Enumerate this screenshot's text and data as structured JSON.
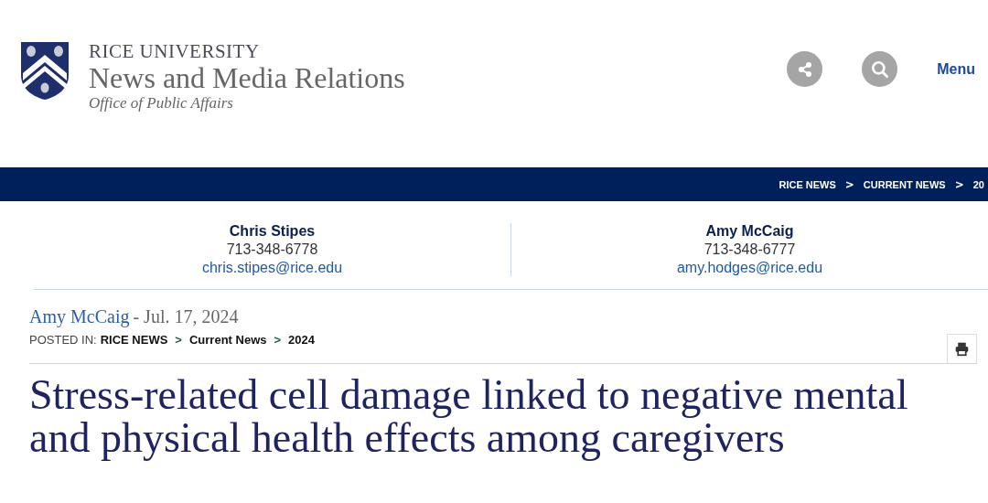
{
  "header": {
    "university": "RICE UNIVERSITY",
    "site_title": "News and Media Relations",
    "office": "Office of Public Affairs",
    "menu_label": "Menu"
  },
  "nav_breadcrumb": [
    "RICE NEWS",
    "CURRENT NEWS",
    "20"
  ],
  "breadcrumb_separator": ">",
  "contacts": [
    {
      "name": "Chris Stipes",
      "phone": "713-348-6778",
      "email": "chris.stipes@rice.edu"
    },
    {
      "name": "Amy McCaig",
      "phone": "713-348-6777",
      "email": "amy.hodges@rice.edu"
    }
  ],
  "byline": {
    "author": "Amy McCaig",
    "date": "- Jul. 17, 2024"
  },
  "posted_in": {
    "label": "POSTED IN:",
    "items": [
      "RICE NEWS",
      "Current News",
      "2024"
    ]
  },
  "headline": "Stress-related cell damage linked to negative mental and physical health effects among caregivers"
}
